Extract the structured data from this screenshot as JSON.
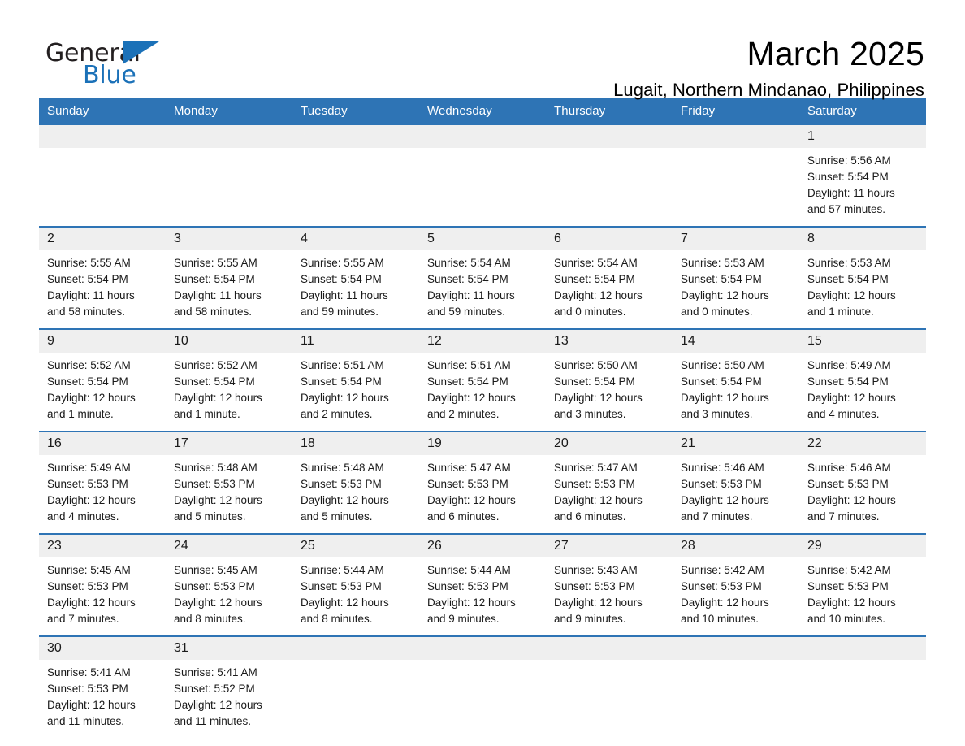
{
  "brand": {
    "word_one": "General",
    "word_two": "Blue",
    "triangle_icon": "brand-triangle-icon",
    "accent_color": "#1b71b8"
  },
  "header": {
    "title": "March 2025",
    "location": "Lugait, Northern Mindanao, Philippines"
  },
  "theme": {
    "header_blue": "#2e74b5",
    "daynum_band": "#efefef",
    "text": "#1a1a1a"
  },
  "calendar": {
    "weekday_headers": [
      "Sunday",
      "Monday",
      "Tuesday",
      "Wednesday",
      "Thursday",
      "Friday",
      "Saturday"
    ],
    "weeks": [
      [
        {
          "day": "",
          "sunrise": "",
          "sunset": "",
          "daylight_line1": "",
          "daylight_line2": ""
        },
        {
          "day": "",
          "sunrise": "",
          "sunset": "",
          "daylight_line1": "",
          "daylight_line2": ""
        },
        {
          "day": "",
          "sunrise": "",
          "sunset": "",
          "daylight_line1": "",
          "daylight_line2": ""
        },
        {
          "day": "",
          "sunrise": "",
          "sunset": "",
          "daylight_line1": "",
          "daylight_line2": ""
        },
        {
          "day": "",
          "sunrise": "",
          "sunset": "",
          "daylight_line1": "",
          "daylight_line2": ""
        },
        {
          "day": "",
          "sunrise": "",
          "sunset": "",
          "daylight_line1": "",
          "daylight_line2": ""
        },
        {
          "day": "1",
          "sunrise": "Sunrise: 5:56 AM",
          "sunset": "Sunset: 5:54 PM",
          "daylight_line1": "Daylight: 11 hours",
          "daylight_line2": "and 57 minutes."
        }
      ],
      [
        {
          "day": "2",
          "sunrise": "Sunrise: 5:55 AM",
          "sunset": "Sunset: 5:54 PM",
          "daylight_line1": "Daylight: 11 hours",
          "daylight_line2": "and 58 minutes."
        },
        {
          "day": "3",
          "sunrise": "Sunrise: 5:55 AM",
          "sunset": "Sunset: 5:54 PM",
          "daylight_line1": "Daylight: 11 hours",
          "daylight_line2": "and 58 minutes."
        },
        {
          "day": "4",
          "sunrise": "Sunrise: 5:55 AM",
          "sunset": "Sunset: 5:54 PM",
          "daylight_line1": "Daylight: 11 hours",
          "daylight_line2": "and 59 minutes."
        },
        {
          "day": "5",
          "sunrise": "Sunrise: 5:54 AM",
          "sunset": "Sunset: 5:54 PM",
          "daylight_line1": "Daylight: 11 hours",
          "daylight_line2": "and 59 minutes."
        },
        {
          "day": "6",
          "sunrise": "Sunrise: 5:54 AM",
          "sunset": "Sunset: 5:54 PM",
          "daylight_line1": "Daylight: 12 hours",
          "daylight_line2": "and 0 minutes."
        },
        {
          "day": "7",
          "sunrise": "Sunrise: 5:53 AM",
          "sunset": "Sunset: 5:54 PM",
          "daylight_line1": "Daylight: 12 hours",
          "daylight_line2": "and 0 minutes."
        },
        {
          "day": "8",
          "sunrise": "Sunrise: 5:53 AM",
          "sunset": "Sunset: 5:54 PM",
          "daylight_line1": "Daylight: 12 hours",
          "daylight_line2": "and 1 minute."
        }
      ],
      [
        {
          "day": "9",
          "sunrise": "Sunrise: 5:52 AM",
          "sunset": "Sunset: 5:54 PM",
          "daylight_line1": "Daylight: 12 hours",
          "daylight_line2": "and 1 minute."
        },
        {
          "day": "10",
          "sunrise": "Sunrise: 5:52 AM",
          "sunset": "Sunset: 5:54 PM",
          "daylight_line1": "Daylight: 12 hours",
          "daylight_line2": "and 1 minute."
        },
        {
          "day": "11",
          "sunrise": "Sunrise: 5:51 AM",
          "sunset": "Sunset: 5:54 PM",
          "daylight_line1": "Daylight: 12 hours",
          "daylight_line2": "and 2 minutes."
        },
        {
          "day": "12",
          "sunrise": "Sunrise: 5:51 AM",
          "sunset": "Sunset: 5:54 PM",
          "daylight_line1": "Daylight: 12 hours",
          "daylight_line2": "and 2 minutes."
        },
        {
          "day": "13",
          "sunrise": "Sunrise: 5:50 AM",
          "sunset": "Sunset: 5:54 PM",
          "daylight_line1": "Daylight: 12 hours",
          "daylight_line2": "and 3 minutes."
        },
        {
          "day": "14",
          "sunrise": "Sunrise: 5:50 AM",
          "sunset": "Sunset: 5:54 PM",
          "daylight_line1": "Daylight: 12 hours",
          "daylight_line2": "and 3 minutes."
        },
        {
          "day": "15",
          "sunrise": "Sunrise: 5:49 AM",
          "sunset": "Sunset: 5:54 PM",
          "daylight_line1": "Daylight: 12 hours",
          "daylight_line2": "and 4 minutes."
        }
      ],
      [
        {
          "day": "16",
          "sunrise": "Sunrise: 5:49 AM",
          "sunset": "Sunset: 5:53 PM",
          "daylight_line1": "Daylight: 12 hours",
          "daylight_line2": "and 4 minutes."
        },
        {
          "day": "17",
          "sunrise": "Sunrise: 5:48 AM",
          "sunset": "Sunset: 5:53 PM",
          "daylight_line1": "Daylight: 12 hours",
          "daylight_line2": "and 5 minutes."
        },
        {
          "day": "18",
          "sunrise": "Sunrise: 5:48 AM",
          "sunset": "Sunset: 5:53 PM",
          "daylight_line1": "Daylight: 12 hours",
          "daylight_line2": "and 5 minutes."
        },
        {
          "day": "19",
          "sunrise": "Sunrise: 5:47 AM",
          "sunset": "Sunset: 5:53 PM",
          "daylight_line1": "Daylight: 12 hours",
          "daylight_line2": "and 6 minutes."
        },
        {
          "day": "20",
          "sunrise": "Sunrise: 5:47 AM",
          "sunset": "Sunset: 5:53 PM",
          "daylight_line1": "Daylight: 12 hours",
          "daylight_line2": "and 6 minutes."
        },
        {
          "day": "21",
          "sunrise": "Sunrise: 5:46 AM",
          "sunset": "Sunset: 5:53 PM",
          "daylight_line1": "Daylight: 12 hours",
          "daylight_line2": "and 7 minutes."
        },
        {
          "day": "22",
          "sunrise": "Sunrise: 5:46 AM",
          "sunset": "Sunset: 5:53 PM",
          "daylight_line1": "Daylight: 12 hours",
          "daylight_line2": "and 7 minutes."
        }
      ],
      [
        {
          "day": "23",
          "sunrise": "Sunrise: 5:45 AM",
          "sunset": "Sunset: 5:53 PM",
          "daylight_line1": "Daylight: 12 hours",
          "daylight_line2": "and 7 minutes."
        },
        {
          "day": "24",
          "sunrise": "Sunrise: 5:45 AM",
          "sunset": "Sunset: 5:53 PM",
          "daylight_line1": "Daylight: 12 hours",
          "daylight_line2": "and 8 minutes."
        },
        {
          "day": "25",
          "sunrise": "Sunrise: 5:44 AM",
          "sunset": "Sunset: 5:53 PM",
          "daylight_line1": "Daylight: 12 hours",
          "daylight_line2": "and 8 minutes."
        },
        {
          "day": "26",
          "sunrise": "Sunrise: 5:44 AM",
          "sunset": "Sunset: 5:53 PM",
          "daylight_line1": "Daylight: 12 hours",
          "daylight_line2": "and 9 minutes."
        },
        {
          "day": "27",
          "sunrise": "Sunrise: 5:43 AM",
          "sunset": "Sunset: 5:53 PM",
          "daylight_line1": "Daylight: 12 hours",
          "daylight_line2": "and 9 minutes."
        },
        {
          "day": "28",
          "sunrise": "Sunrise: 5:42 AM",
          "sunset": "Sunset: 5:53 PM",
          "daylight_line1": "Daylight: 12 hours",
          "daylight_line2": "and 10 minutes."
        },
        {
          "day": "29",
          "sunrise": "Sunrise: 5:42 AM",
          "sunset": "Sunset: 5:53 PM",
          "daylight_line1": "Daylight: 12 hours",
          "daylight_line2": "and 10 minutes."
        }
      ],
      [
        {
          "day": "30",
          "sunrise": "Sunrise: 5:41 AM",
          "sunset": "Sunset: 5:53 PM",
          "daylight_line1": "Daylight: 12 hours",
          "daylight_line2": "and 11 minutes."
        },
        {
          "day": "31",
          "sunrise": "Sunrise: 5:41 AM",
          "sunset": "Sunset: 5:52 PM",
          "daylight_line1": "Daylight: 12 hours",
          "daylight_line2": "and 11 minutes."
        },
        {
          "day": "",
          "sunrise": "",
          "sunset": "",
          "daylight_line1": "",
          "daylight_line2": ""
        },
        {
          "day": "",
          "sunrise": "",
          "sunset": "",
          "daylight_line1": "",
          "daylight_line2": ""
        },
        {
          "day": "",
          "sunrise": "",
          "sunset": "",
          "daylight_line1": "",
          "daylight_line2": ""
        },
        {
          "day": "",
          "sunrise": "",
          "sunset": "",
          "daylight_line1": "",
          "daylight_line2": ""
        },
        {
          "day": "",
          "sunrise": "",
          "sunset": "",
          "daylight_line1": "",
          "daylight_line2": ""
        }
      ]
    ]
  }
}
